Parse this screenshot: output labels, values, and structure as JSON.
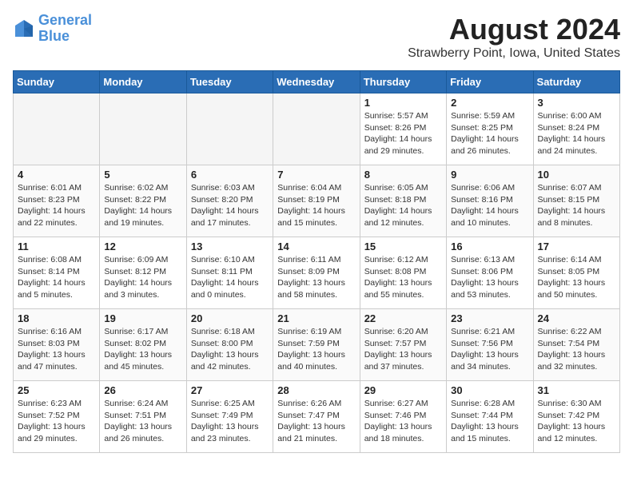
{
  "header": {
    "logo_line1": "General",
    "logo_line2": "Blue",
    "title": "August 2024",
    "subtitle": "Strawberry Point, Iowa, United States"
  },
  "days_of_week": [
    "Sunday",
    "Monday",
    "Tuesday",
    "Wednesday",
    "Thursday",
    "Friday",
    "Saturday"
  ],
  "weeks": [
    [
      {
        "day": "",
        "detail": ""
      },
      {
        "day": "",
        "detail": ""
      },
      {
        "day": "",
        "detail": ""
      },
      {
        "day": "",
        "detail": ""
      },
      {
        "day": "1",
        "detail": "Sunrise: 5:57 AM\nSunset: 8:26 PM\nDaylight: 14 hours\nand 29 minutes."
      },
      {
        "day": "2",
        "detail": "Sunrise: 5:59 AM\nSunset: 8:25 PM\nDaylight: 14 hours\nand 26 minutes."
      },
      {
        "day": "3",
        "detail": "Sunrise: 6:00 AM\nSunset: 8:24 PM\nDaylight: 14 hours\nand 24 minutes."
      }
    ],
    [
      {
        "day": "4",
        "detail": "Sunrise: 6:01 AM\nSunset: 8:23 PM\nDaylight: 14 hours\nand 22 minutes."
      },
      {
        "day": "5",
        "detail": "Sunrise: 6:02 AM\nSunset: 8:22 PM\nDaylight: 14 hours\nand 19 minutes."
      },
      {
        "day": "6",
        "detail": "Sunrise: 6:03 AM\nSunset: 8:20 PM\nDaylight: 14 hours\nand 17 minutes."
      },
      {
        "day": "7",
        "detail": "Sunrise: 6:04 AM\nSunset: 8:19 PM\nDaylight: 14 hours\nand 15 minutes."
      },
      {
        "day": "8",
        "detail": "Sunrise: 6:05 AM\nSunset: 8:18 PM\nDaylight: 14 hours\nand 12 minutes."
      },
      {
        "day": "9",
        "detail": "Sunrise: 6:06 AM\nSunset: 8:16 PM\nDaylight: 14 hours\nand 10 minutes."
      },
      {
        "day": "10",
        "detail": "Sunrise: 6:07 AM\nSunset: 8:15 PM\nDaylight: 14 hours\nand 8 minutes."
      }
    ],
    [
      {
        "day": "11",
        "detail": "Sunrise: 6:08 AM\nSunset: 8:14 PM\nDaylight: 14 hours\nand 5 minutes."
      },
      {
        "day": "12",
        "detail": "Sunrise: 6:09 AM\nSunset: 8:12 PM\nDaylight: 14 hours\nand 3 minutes."
      },
      {
        "day": "13",
        "detail": "Sunrise: 6:10 AM\nSunset: 8:11 PM\nDaylight: 14 hours\nand 0 minutes."
      },
      {
        "day": "14",
        "detail": "Sunrise: 6:11 AM\nSunset: 8:09 PM\nDaylight: 13 hours\nand 58 minutes."
      },
      {
        "day": "15",
        "detail": "Sunrise: 6:12 AM\nSunset: 8:08 PM\nDaylight: 13 hours\nand 55 minutes."
      },
      {
        "day": "16",
        "detail": "Sunrise: 6:13 AM\nSunset: 8:06 PM\nDaylight: 13 hours\nand 53 minutes."
      },
      {
        "day": "17",
        "detail": "Sunrise: 6:14 AM\nSunset: 8:05 PM\nDaylight: 13 hours\nand 50 minutes."
      }
    ],
    [
      {
        "day": "18",
        "detail": "Sunrise: 6:16 AM\nSunset: 8:03 PM\nDaylight: 13 hours\nand 47 minutes."
      },
      {
        "day": "19",
        "detail": "Sunrise: 6:17 AM\nSunset: 8:02 PM\nDaylight: 13 hours\nand 45 minutes."
      },
      {
        "day": "20",
        "detail": "Sunrise: 6:18 AM\nSunset: 8:00 PM\nDaylight: 13 hours\nand 42 minutes."
      },
      {
        "day": "21",
        "detail": "Sunrise: 6:19 AM\nSunset: 7:59 PM\nDaylight: 13 hours\nand 40 minutes."
      },
      {
        "day": "22",
        "detail": "Sunrise: 6:20 AM\nSunset: 7:57 PM\nDaylight: 13 hours\nand 37 minutes."
      },
      {
        "day": "23",
        "detail": "Sunrise: 6:21 AM\nSunset: 7:56 PM\nDaylight: 13 hours\nand 34 minutes."
      },
      {
        "day": "24",
        "detail": "Sunrise: 6:22 AM\nSunset: 7:54 PM\nDaylight: 13 hours\nand 32 minutes."
      }
    ],
    [
      {
        "day": "25",
        "detail": "Sunrise: 6:23 AM\nSunset: 7:52 PM\nDaylight: 13 hours\nand 29 minutes."
      },
      {
        "day": "26",
        "detail": "Sunrise: 6:24 AM\nSunset: 7:51 PM\nDaylight: 13 hours\nand 26 minutes."
      },
      {
        "day": "27",
        "detail": "Sunrise: 6:25 AM\nSunset: 7:49 PM\nDaylight: 13 hours\nand 23 minutes."
      },
      {
        "day": "28",
        "detail": "Sunrise: 6:26 AM\nSunset: 7:47 PM\nDaylight: 13 hours\nand 21 minutes."
      },
      {
        "day": "29",
        "detail": "Sunrise: 6:27 AM\nSunset: 7:46 PM\nDaylight: 13 hours\nand 18 minutes."
      },
      {
        "day": "30",
        "detail": "Sunrise: 6:28 AM\nSunset: 7:44 PM\nDaylight: 13 hours\nand 15 minutes."
      },
      {
        "day": "31",
        "detail": "Sunrise: 6:30 AM\nSunset: 7:42 PM\nDaylight: 13 hours\nand 12 minutes."
      }
    ]
  ]
}
